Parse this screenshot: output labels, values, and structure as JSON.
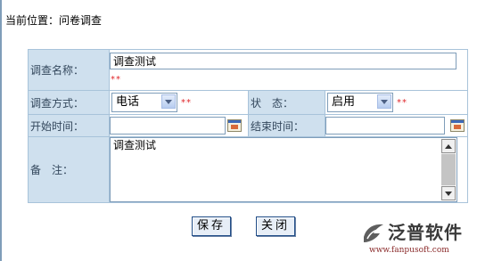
{
  "breadcrumb": {
    "text": "当前位置：问卷调查"
  },
  "form": {
    "survey_name": {
      "label": "调查名称：",
      "value": "调查测试",
      "required_mark": "**"
    },
    "survey_method": {
      "label": "调查方式：",
      "selected": "电话",
      "required_mark": "**"
    },
    "status": {
      "label": "状　态：",
      "selected": "启用",
      "required_mark": "**"
    },
    "start_time": {
      "label": "开始时间：",
      "value": ""
    },
    "end_time": {
      "label": "结束时间：",
      "value": ""
    },
    "remarks": {
      "label": "备　注：",
      "value": "调查测试"
    }
  },
  "buttons": {
    "save": "保存",
    "close": "关闭"
  },
  "logo": {
    "brand": "泛普软件",
    "url": "www.fanpusoft.com"
  },
  "colors": {
    "label_bg": "#cfe0ee",
    "border": "#a8c3da",
    "required": "#e0262a",
    "button_border": "#1f4c87"
  },
  "icons": [
    "calendar-icon",
    "dropdown-arrow-icon",
    "scroll-up-icon",
    "scroll-down-icon",
    "fanpu-logo-icon"
  ]
}
